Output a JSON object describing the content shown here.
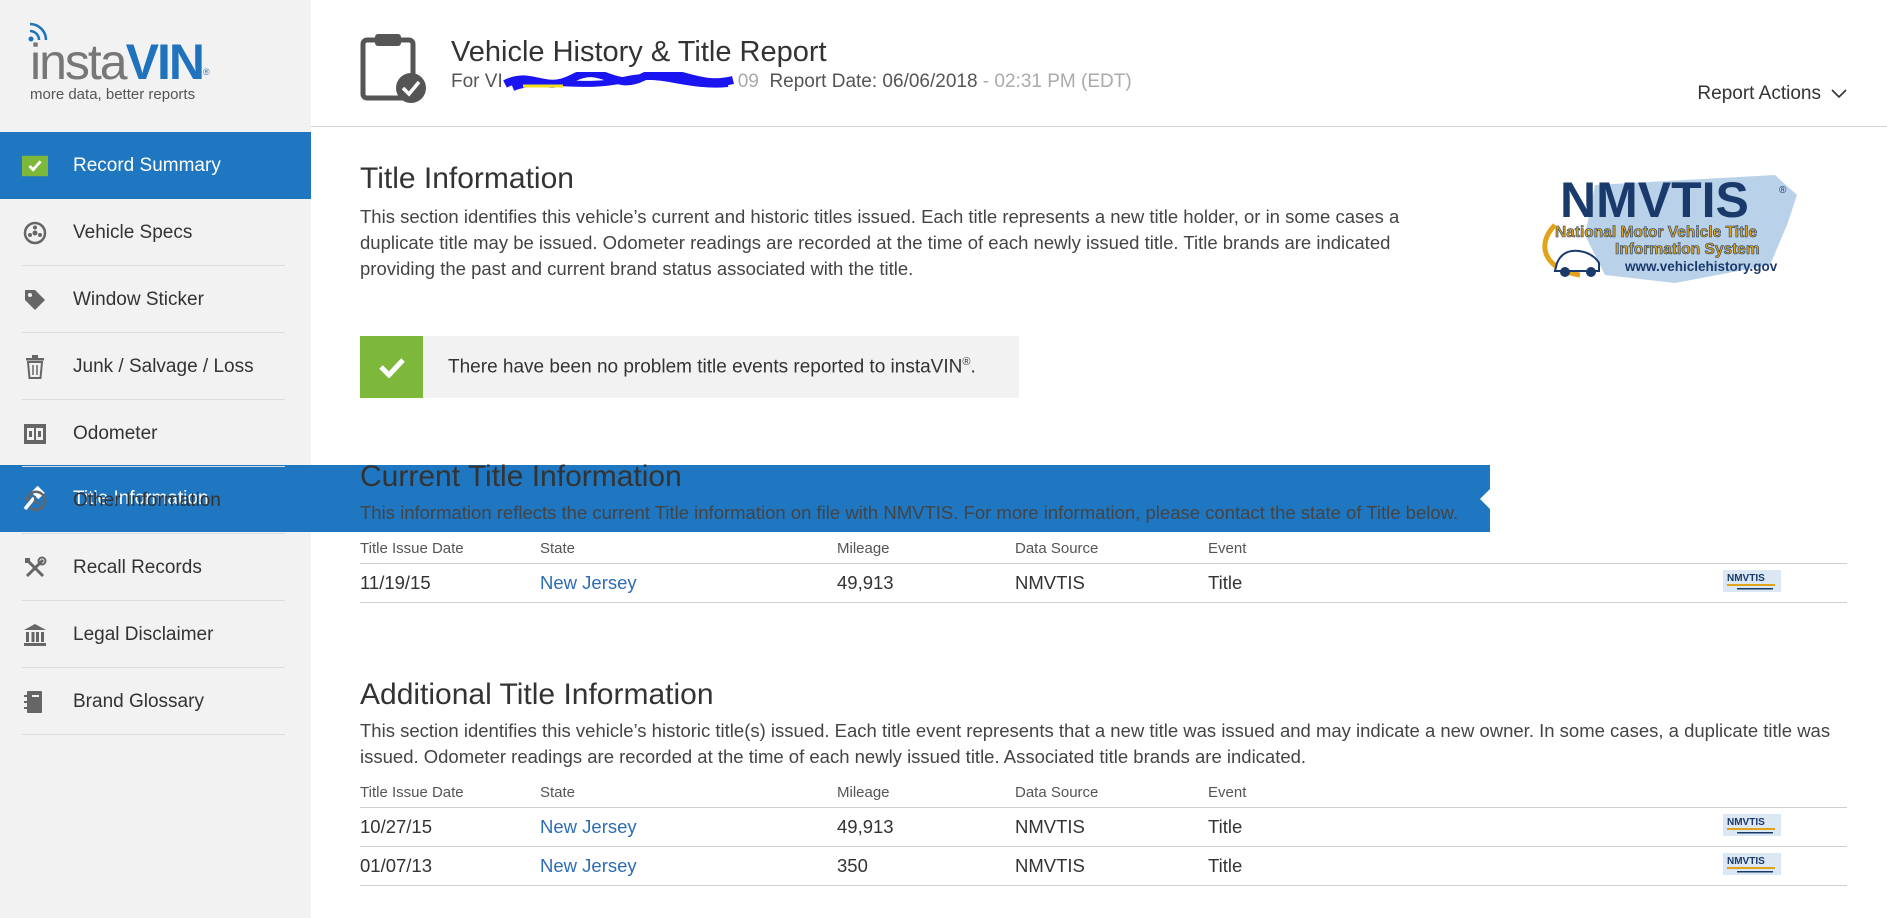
{
  "brand": {
    "logo_insta": "insta",
    "logo_vin": "VIN",
    "logo_reg": "®",
    "tagline": "more data, better reports"
  },
  "sidebar": {
    "items": [
      {
        "label": "Record Summary",
        "icon": "check-square-icon"
      },
      {
        "label": "Vehicle Specs",
        "icon": "wheel-icon"
      },
      {
        "label": "Window Sticker",
        "icon": "tag-icon"
      },
      {
        "label": "Junk / Salvage / Loss",
        "icon": "trash-icon"
      },
      {
        "label": "Title Information",
        "icon": "hammer-icon"
      },
      {
        "label": "Odometer",
        "icon": "odometer-icon"
      },
      {
        "label": "Other Information",
        "icon": "history-icon"
      },
      {
        "label": "Recall Records",
        "icon": "tools-icon"
      },
      {
        "label": "Legal Disclaimer",
        "icon": "bank-icon"
      },
      {
        "label": "Brand Glossary",
        "icon": "book-icon"
      }
    ]
  },
  "header": {
    "title": "Vehicle History & Title Report",
    "for_prefix": "For VI",
    "vin_suffix": "09",
    "report_date_label": "Report Date: 06/06/2018",
    "report_time": " - 02:31 PM (EDT)",
    "actions_label": "Report Actions"
  },
  "title_info": {
    "heading": "Title Information",
    "description": "This section identifies this vehicle’s current and historic titles issued. Each title represents a new title holder, or in some cases a duplicate title may be issued. Odometer readings are recorded at the time of each newly issued title. Title brands are indicated providing the past and current brand status associated with the title.",
    "status_message": "There have been no problem title events reported to instaVIN",
    "status_reg": "®",
    "status_end": "."
  },
  "nmvtis": {
    "name": "NMVTIS",
    "reg": "®",
    "line1": "National Motor Vehicle Title",
    "line2": "Information System",
    "url": "www.vehiclehistory.gov",
    "mini": "NMVTIS"
  },
  "columns": [
    "Title Issue Date",
    "State",
    "Mileage",
    "Data Source",
    "Event"
  ],
  "current_title": {
    "heading": "Current Title Information",
    "description": "This information reflects the current Title information on file with NMVTIS. For more information, please contact the state of Title below.",
    "rows": [
      {
        "date": "11/19/15",
        "state": "New Jersey",
        "mileage": "49,913",
        "source": "NMVTIS",
        "event": "Title"
      }
    ]
  },
  "additional_title": {
    "heading": "Additional Title Information",
    "description": "This section identifies this vehicle’s historic title(s) issued. Each title event represents that a new title was issued and may indicate a new owner. In some cases, a duplicate title was issued. Odometer readings are recorded at the time of each newly issued title. Associated title brands are indicated.",
    "rows": [
      {
        "date": "10/27/15",
        "state": "New Jersey",
        "mileage": "49,913",
        "source": "NMVTIS",
        "event": "Title"
      },
      {
        "date": "01/07/13",
        "state": "New Jersey",
        "mileage": "350",
        "source": "NMVTIS",
        "event": "Title"
      }
    ]
  },
  "colors": {
    "accent": "#1f76c1",
    "ok_green": "#7db83a",
    "link": "#2c6cb5",
    "nmvtis_navy": "#1a3a6b",
    "nmvtis_gold": "#e0a31a"
  }
}
